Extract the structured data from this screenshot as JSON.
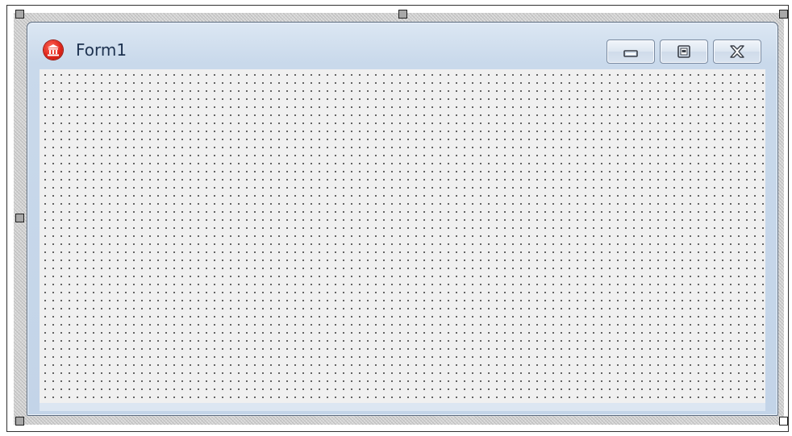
{
  "form": {
    "title": "Form1",
    "icon": "app-icon-red-building",
    "buttons": {
      "minimize_icon": "minimize-icon",
      "maximize_icon": "maximize-icon",
      "close_icon": "close-icon"
    }
  },
  "designer": {
    "grid": "dotted",
    "selection_handles": 8
  },
  "colors": {
    "client_background": "#f0f0f0",
    "frame_background": "#c9d9eb",
    "title_text": "#1e3250",
    "icon_red": "#e0251a"
  }
}
